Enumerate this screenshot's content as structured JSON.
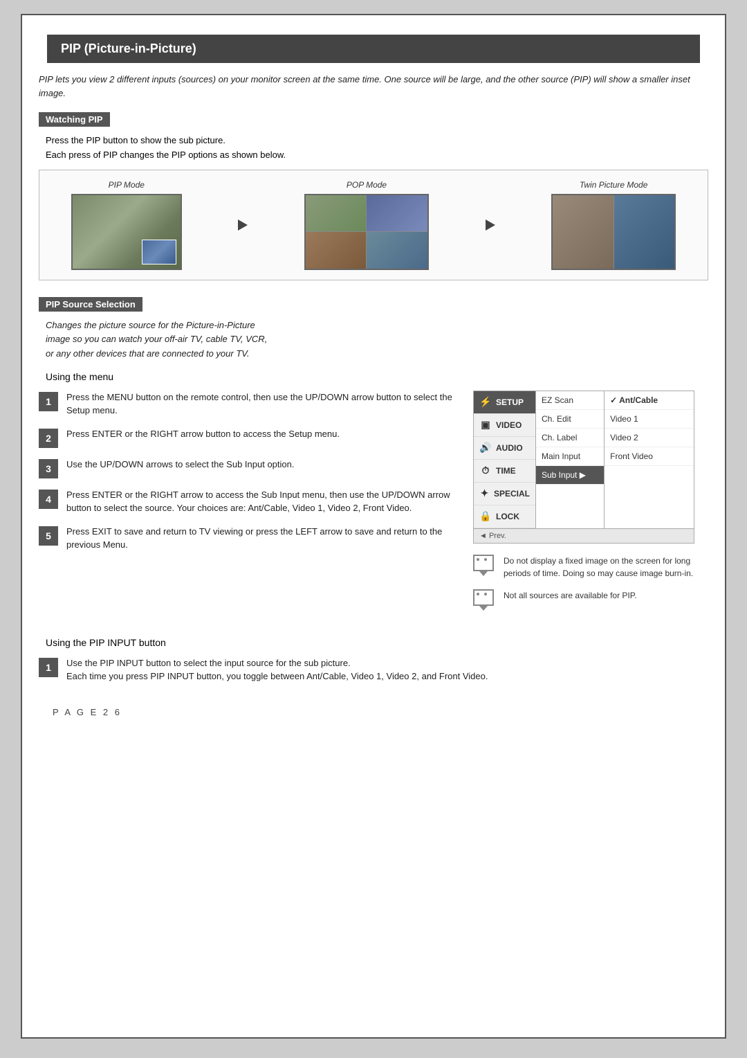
{
  "page": {
    "title": "PIP (Picture-in-Picture)",
    "intro": "PIP lets you view 2 different inputs (sources) on your monitor screen at the same time. One source will be large, and the other source (PIP) will show a smaller inset image.",
    "watching_pip": {
      "label": "Watching PIP",
      "instruction_line1": "Press the PIP button to show the sub picture.",
      "instruction_line2": "Each press of PIP changes the PIP options as shown below.",
      "mode1_label": "PIP Mode",
      "mode2_label": "POP Mode",
      "mode3_label": "Twin Picture Mode"
    },
    "pip_source": {
      "label": "PIP Source Selection",
      "description": "Changes the picture source for the Picture-in-Picture\nimage so you can watch your off-air TV, cable TV, VCR,\nor any other devices that are connected to your TV.",
      "using_menu_label": "Using the menu",
      "steps": [
        {
          "num": "1",
          "text": "Press the MENU button on the remote control, then use the UP/DOWN arrow button to select the Setup menu."
        },
        {
          "num": "2",
          "text": "Press ENTER or the RIGHT arrow button to access the Setup menu."
        },
        {
          "num": "3",
          "text": "Use the UP/DOWN arrows to select the Sub Input option."
        },
        {
          "num": "4",
          "text": "Press ENTER or the RIGHT arrow to access the Sub Input menu, then use the UP/DOWN arrow button to select the source. Your choices are: Ant/Cable, Video 1, Video 2, Front Video."
        },
        {
          "num": "5",
          "text": "Press EXIT to save and return to TV viewing or press the LEFT arrow to save and return to the previous Menu."
        }
      ],
      "menu": {
        "items": [
          {
            "icon": "⚡",
            "label": "SETUP",
            "active": true
          },
          {
            "icon": "▣",
            "label": "VIDEO",
            "active": false
          },
          {
            "icon": "🔊",
            "label": "AUDIO",
            "active": false
          },
          {
            "icon": "⏱",
            "label": "TIME",
            "active": false
          },
          {
            "icon": "✦",
            "label": "SPECIAL",
            "active": false
          },
          {
            "icon": "🔒",
            "label": "LOCK",
            "active": false
          }
        ],
        "center_items": [
          {
            "label": "EZ Scan",
            "highlighted": false
          },
          {
            "label": "Ch. Edit",
            "highlighted": false
          },
          {
            "label": "Ch. Label",
            "highlighted": false
          },
          {
            "label": "Main Input",
            "highlighted": false
          },
          {
            "label": "Sub Input",
            "highlighted": true
          }
        ],
        "right_items": [
          {
            "label": "✓ Ant/Cable",
            "checked": true
          },
          {
            "label": "Video 1",
            "checked": false
          },
          {
            "label": "Video 2",
            "checked": false
          },
          {
            "label": "Front Video",
            "checked": false
          }
        ],
        "bottom_nav": "◄ Prev."
      },
      "notes": [
        "Do not display a fixed image on the screen for long periods of time. Doing so may cause image burn-in.",
        "Not all sources are available for PIP."
      ]
    },
    "pip_input": {
      "label": "Using the PIP INPUT button",
      "steps": [
        {
          "num": "1",
          "text": "Use the PIP INPUT button to select the input source for the sub picture.\nEach time you press PIP INPUT button, you toggle between Ant/Cable, Video 1, Video 2, and Front Video."
        }
      ]
    },
    "footer": {
      "page_label": "P A G E   2 6"
    }
  }
}
